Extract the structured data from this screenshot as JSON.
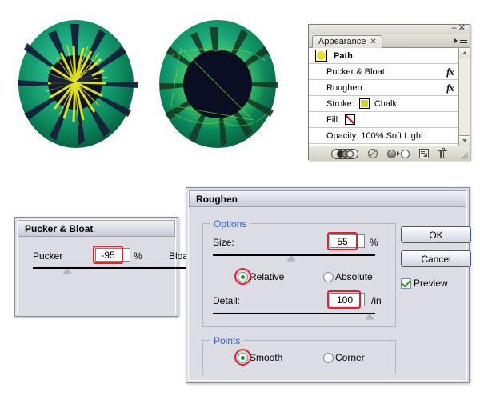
{
  "artwork": {
    "left_eye": {
      "name": "eye-illustration-pucker-bloat",
      "iris_color": "#0a0a1e",
      "sclera_outer": "#0a6b4b",
      "sclera_inner": "#2fbf8f",
      "spike_color": "#e8e81f"
    },
    "right_eye": {
      "name": "eye-illustration-roughen",
      "iris_color": "#0a0a1e",
      "sclera_outer": "#0a6b4b",
      "sclera_inner": "#2fbf8f",
      "spike_color": "#7fe02a"
    }
  },
  "appearance_panel": {
    "window_buttons": {
      "minimize": "–",
      "close": "✕"
    },
    "tab_label": "Appearance",
    "tab_close": "✕",
    "rows": [
      {
        "label": "Path",
        "type": "header",
        "icon": "path-thumbnail-icon",
        "fx": ""
      },
      {
        "label": "Pucker & Bloat",
        "type": "effect",
        "fx": "fx"
      },
      {
        "label": "Roughen",
        "type": "effect",
        "fx": "fx"
      },
      {
        "label": "Stroke:",
        "type": "stroke",
        "swatch_color": "#d4d428",
        "value": "Chalk"
      },
      {
        "label": "Fill:",
        "type": "fill",
        "swatch_color": "none",
        "value": ""
      },
      {
        "label": "Opacity: 100% Soft Light",
        "type": "opacity"
      }
    ],
    "footer_icons": [
      "visibility-toggle-icon",
      "clear-appearance-icon",
      "reduce-to-basic-appearance-icon",
      "duplicate-item-icon",
      "delete-item-icon"
    ]
  },
  "pucker_dialog": {
    "title": "Pucker & Bloat",
    "left_label": "Pucker",
    "right_label": "Bloat",
    "value": "-95",
    "unit": "%",
    "slider_percent": 12
  },
  "roughen_dialog": {
    "title": "Roughen",
    "options_group": "Options",
    "size_label": "Size:",
    "size_value": "55",
    "size_unit": "%",
    "size_slider_percent": 50,
    "relative_label": "Relative",
    "absolute_label": "Absolute",
    "size_mode_selected": "Relative",
    "detail_label": "Detail:",
    "detail_value": "100",
    "detail_unit": "/in",
    "detail_slider_percent": 97,
    "points_group": "Points",
    "smooth_label": "Smooth",
    "corner_label": "Corner",
    "points_selected": "Smooth",
    "ok_label": "OK",
    "cancel_label": "Cancel",
    "preview_label": "Preview",
    "preview_checked": true,
    "highlight_color": "#ee1c25"
  }
}
